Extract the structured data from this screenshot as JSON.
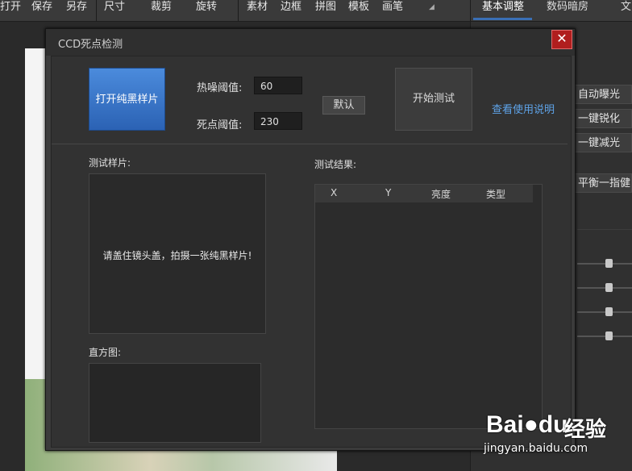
{
  "toolbar": {
    "items": [
      "打开",
      "保存",
      "另存",
      "尺寸",
      "裁剪",
      "旋转",
      "素材",
      "边框",
      "拼图",
      "模板",
      "画笔"
    ],
    "tabs": [
      "基本调整",
      "数码暗房",
      "文"
    ]
  },
  "right_panel": {
    "buttons": [
      "自动曝光",
      "一键锐化",
      "一键减光",
      "平衡一指健"
    ]
  },
  "dialog": {
    "title": "CCD死点检测",
    "close_glyph": "✕",
    "open_button": "打开纯黑样片",
    "hot_noise_label": "热噪阈值:",
    "hot_noise_value": "60",
    "dead_pixel_label": "死点阈值:",
    "dead_pixel_value": "230",
    "default_button": "默认",
    "start_button": "开始测试",
    "help_link": "查看使用说明",
    "sample_label": "测试样片:",
    "sample_hint": "请盖住镜头盖，拍摄一张纯黑样片!",
    "histogram_label": "直方图:",
    "results_label": "测试结果:",
    "results_columns": [
      "X",
      "Y",
      "亮度",
      "类型"
    ]
  },
  "watermark": {
    "brand": "Bai",
    "brand_suffix": "du",
    "cn": "经验",
    "url": "jingyan.baidu.com"
  }
}
